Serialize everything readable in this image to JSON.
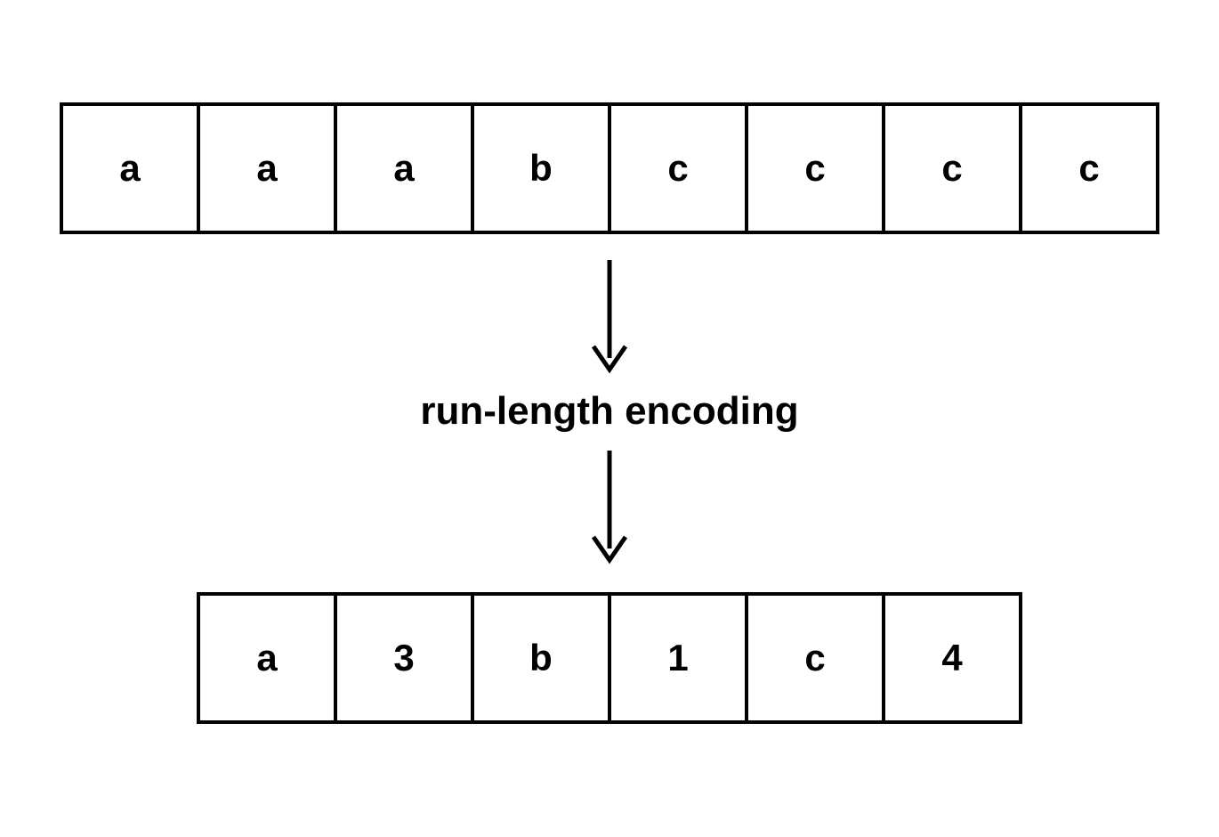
{
  "diagram": {
    "label": "run-length encoding",
    "input_cells": [
      "a",
      "a",
      "a",
      "b",
      "c",
      "c",
      "c",
      "c"
    ],
    "output_cells": [
      "a",
      "3",
      "b",
      "1",
      "c",
      "4"
    ]
  }
}
